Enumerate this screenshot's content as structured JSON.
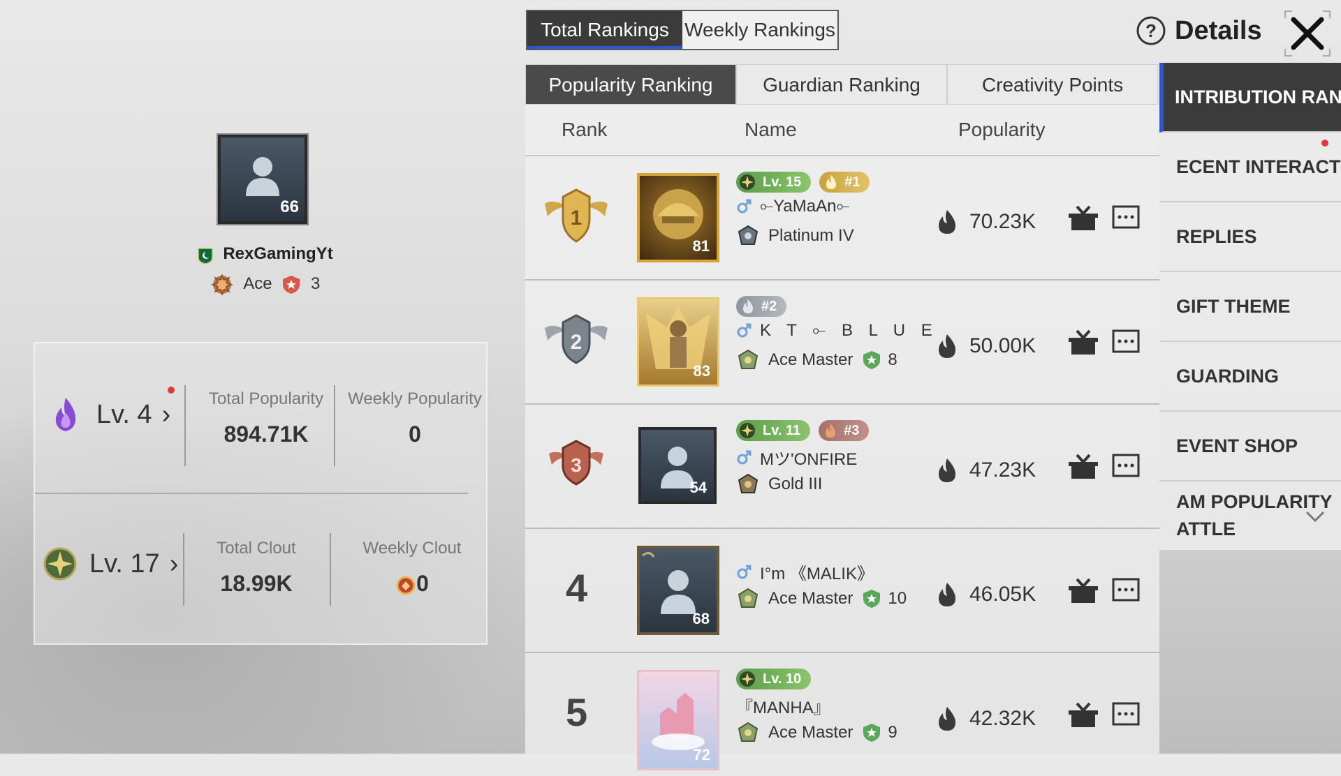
{
  "profile": {
    "avatar_level": "66",
    "name": "RexGamingYt",
    "tier": "Ace",
    "tier_stars": "3"
  },
  "stats": {
    "pop_level": "Lv. 4",
    "total_popularity_label": "Total Popularity",
    "total_popularity": "894.71K",
    "weekly_popularity_label": "Weekly Popularity",
    "weekly_popularity": "0",
    "clout_level": "Lv. 17",
    "total_clout_label": "Total Clout",
    "total_clout": "18.99K",
    "weekly_clout_label": "Weekly Clout",
    "weekly_clout": "0"
  },
  "top_tabs": [
    "Total Rankings",
    "Weekly Rankings"
  ],
  "details_label": "Details",
  "sub_tabs": [
    "Popularity Ranking",
    "Guardian Ranking",
    "Creativity Points"
  ],
  "columns": {
    "rank": "Rank",
    "name": "Name",
    "popularity": "Popularity"
  },
  "rows": [
    {
      "rank": "1",
      "avatar_level": "81",
      "lv": "Lv. 15",
      "badge": "#1",
      "name": "⟜YaMaAn⟜",
      "tier": "Platinum IV",
      "tier_num": "",
      "popularity": "70.23K"
    },
    {
      "rank": "2",
      "avatar_level": "83",
      "lv": "",
      "badge": "#2",
      "name": "K T ⟜ B L U E",
      "tier": "Ace Master",
      "tier_num": "8",
      "popularity": "50.00K"
    },
    {
      "rank": "3",
      "avatar_level": "54",
      "lv": "Lv. 11",
      "badge": "#3",
      "name": "Mツ'ONFIRE",
      "tier": "Gold III",
      "tier_num": "",
      "popularity": "47.23K"
    },
    {
      "rank": "4",
      "avatar_level": "68",
      "lv": "",
      "badge": "",
      "name": "I°m 《MALIK》",
      "tier": "Ace Master",
      "tier_num": "10",
      "popularity": "46.05K"
    },
    {
      "rank": "5",
      "avatar_level": "72",
      "lv": "Lv. 10",
      "badge": "",
      "name": "『MANHA』",
      "tier": "Ace Master",
      "tier_num": "9",
      "popularity": "42.32K"
    }
  ],
  "side_menu": [
    "INTRIBUTION RANKI",
    "ECENT INTERACTION",
    "REPLIES",
    "GIFT THEME",
    "GUARDING",
    "EVENT SHOP",
    "AM POPULARITY",
    "ATTLE"
  ],
  "colors": {
    "accent_blue": "#2f55c8",
    "dark_tab": "#3b3b3b",
    "level_green": "#6aab55",
    "rank_gold": "#d8a43a"
  }
}
